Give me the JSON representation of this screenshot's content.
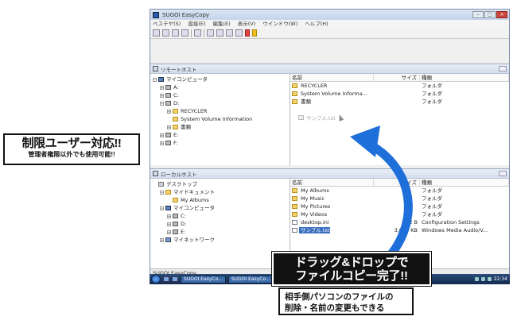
{
  "badge": {
    "title": "制限ユーザー対応!!",
    "subtitle": "管理者権限以外でも使用可能!!"
  },
  "window": {
    "title": "SUGOI EasyCopy",
    "min_label": "‒",
    "max_label": "□",
    "close_label": "×"
  },
  "menu": [
    "ベステヤ(S)",
    "直接(E)",
    "編集(E)",
    "表示(V)",
    "ウインドウ(W)",
    "ヘルプ(H)"
  ],
  "remote_pane": {
    "title": "リモートホスト",
    "tree": [
      {
        "label": "マイコンピュータ",
        "icon": "pc-icon",
        "depth": 0,
        "expander": "−"
      },
      {
        "label": "A:",
        "icon": "drive-icon",
        "depth": 1,
        "expander": "+"
      },
      {
        "label": "C:",
        "icon": "drive-icon",
        "depth": 1,
        "expander": "+"
      },
      {
        "label": "D:",
        "icon": "drive-icon",
        "depth": 1,
        "expander": "−"
      },
      {
        "label": "RECYCLER",
        "icon": "folder-icon",
        "depth": 2,
        "expander": "+"
      },
      {
        "label": "System Volume Information",
        "icon": "folder-icon",
        "depth": 2,
        "expander": ""
      },
      {
        "label": "書類",
        "icon": "folder-icon",
        "depth": 2,
        "expander": "+"
      },
      {
        "label": "E:",
        "icon": "drive-icon",
        "depth": 1,
        "expander": "+"
      },
      {
        "label": "F:",
        "icon": "drive-icon",
        "depth": 1,
        "expander": "+"
      }
    ],
    "columns": {
      "name": "名前",
      "size": "サイズ",
      "type": "種類"
    },
    "rows": [
      {
        "name": "RECYCLER",
        "size": "",
        "type": "フォルダ",
        "icon": "folder-icon"
      },
      {
        "name": "System Volume Informa...",
        "size": "",
        "type": "フォルダ",
        "icon": "folder-icon"
      },
      {
        "name": "書類",
        "size": "",
        "type": "フォルダ",
        "icon": "folder-icon"
      }
    ],
    "ghost_item": "サンプル.txt"
  },
  "local_pane": {
    "title": "ローカルホスト",
    "tree": [
      {
        "label": "デスクトップ",
        "icon": "desktop-icon",
        "depth": 0,
        "expander": ""
      },
      {
        "label": "マイドキュメント",
        "icon": "documents-icon",
        "depth": 1,
        "expander": "−"
      },
      {
        "label": "My Albums",
        "icon": "folder-icon",
        "depth": 2,
        "expander": ""
      },
      {
        "label": "マイコンピュータ",
        "icon": "pc-icon",
        "depth": 1,
        "expander": "−"
      },
      {
        "label": "C:",
        "icon": "drive-icon",
        "depth": 2,
        "expander": "+"
      },
      {
        "label": "D:",
        "icon": "drive-icon",
        "depth": 2,
        "expander": "+"
      },
      {
        "label": "E:",
        "icon": "drive-icon",
        "depth": 2,
        "expander": "+"
      },
      {
        "label": "マイネットワーク",
        "icon": "network-icon",
        "depth": 1,
        "expander": "+"
      }
    ],
    "columns": {
      "name": "名前",
      "size": "サイズ",
      "type": "種類"
    },
    "rows": [
      {
        "name": "My Albums",
        "size": "",
        "type": "フォルダ",
        "icon": "folder-icon",
        "selected": false
      },
      {
        "name": "My Music",
        "size": "",
        "type": "フォルダ",
        "icon": "folder-icon",
        "selected": false
      },
      {
        "name": "My Pictures",
        "size": "",
        "type": "フォルダ",
        "icon": "folder-icon",
        "selected": false
      },
      {
        "name": "My Videos",
        "size": "",
        "type": "フォルダ",
        "icon": "folder-icon",
        "selected": false
      },
      {
        "name": "desktop.ini",
        "size": "412 B",
        "type": "Configuration Settings",
        "icon": "file-icon",
        "selected": false
      },
      {
        "name": "サンプル.txt",
        "size": "3,048 KB",
        "type": "Windows Media Audio/V...",
        "icon": "file-icon",
        "selected": true
      }
    ]
  },
  "statusbar": {
    "text": "SUGOI EasyCopy"
  },
  "taskbar": {
    "tasks": [
      "SUGOI EasyCo...",
      "SUGOI EasyCo..."
    ],
    "clock": "22:34"
  },
  "callout_main": {
    "line1": "ドラッグ&ドロップで",
    "line2": "ファイルコピー完了!!"
  },
  "callout_sub": {
    "line1": "相手側パソコンのファイルの",
    "line2": "削除・名前の変更もできる"
  },
  "colors": {
    "arrow": "#1e6fd9",
    "selection": "#3a6ec0",
    "taskbar": "#1c3a66"
  }
}
